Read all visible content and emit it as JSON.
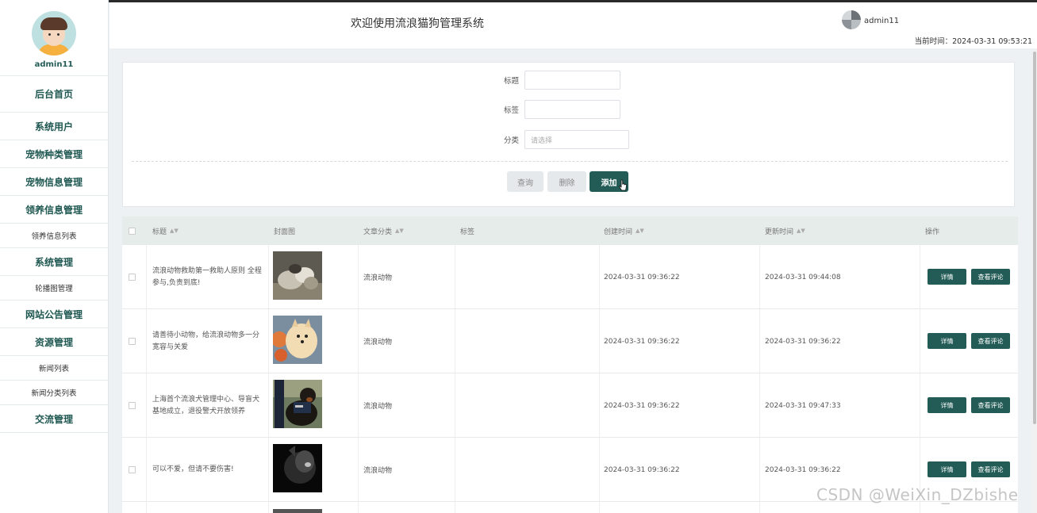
{
  "sidebar": {
    "username": "admin11",
    "menu": [
      {
        "label": "后台首页",
        "type": "big"
      },
      {
        "label": "系统用户",
        "type": "group"
      },
      {
        "label": "宠物种类管理",
        "type": "group"
      },
      {
        "label": "宠物信息管理",
        "type": "group"
      },
      {
        "label": "领养信息管理",
        "type": "group"
      },
      {
        "label": "领养信息列表",
        "type": "sub"
      },
      {
        "label": "系统管理",
        "type": "group"
      },
      {
        "label": "轮播图管理",
        "type": "sub"
      },
      {
        "label": "网站公告管理",
        "type": "group"
      },
      {
        "label": "资源管理",
        "type": "group"
      },
      {
        "label": "新闻列表",
        "type": "sub"
      },
      {
        "label": "新闻分类列表",
        "type": "sub"
      },
      {
        "label": "交流管理",
        "type": "group"
      }
    ]
  },
  "header": {
    "title": "欢迎使用流浪猫狗管理系统",
    "username": "admin11",
    "time_label": "当前时间：2024-03-31 09:53:21"
  },
  "search": {
    "title_label": "标题",
    "title_value": "",
    "tag_label": "标签",
    "tag_value": "",
    "category_label": "分类",
    "category_placeholder": "请选择",
    "query_button": "查询",
    "delete_button": "删除",
    "add_button": "添加"
  },
  "table": {
    "headers": [
      "标题",
      "封面图",
      "文章分类",
      "标签",
      "创建时间",
      "更新时间",
      "操作"
    ],
    "rows": [
      {
        "title": "流浪动物救助第一救助人原则 全程参与,负责到底!",
        "category": "流浪动物",
        "tag": "",
        "created": "2024-03-31 09:36:22",
        "updated": "2024-03-31 09:44:08",
        "image": "cat-photo"
      },
      {
        "title": "请善待小动物，给流浪动物多一分宽容与关爱",
        "category": "流浪动物",
        "tag": "",
        "created": "2024-03-31 09:36:22",
        "updated": "2024-03-31 09:36:22",
        "image": "pomeranian-photo"
      },
      {
        "title": "上海首个流浪犬管理中心、导盲犬基地成立，退役警犬开放领养",
        "category": "流浪动物",
        "tag": "",
        "created": "2024-03-31 09:36:22",
        "updated": "2024-03-31 09:47:33",
        "image": "rottweiler-photo"
      },
      {
        "title": "可以不爱，但请不要伤害!",
        "category": "流浪动物",
        "tag": "",
        "created": "2024-03-31 09:36:22",
        "updated": "2024-03-31 09:36:22",
        "image": "dark-cat-photo"
      }
    ],
    "detail_button": "详情",
    "comment_button": "查看评论"
  },
  "watermark": "CSDN @WeiXin_DZbishe",
  "colors": {
    "accent": "#235c57",
    "header_bg": "#e6ecea"
  }
}
